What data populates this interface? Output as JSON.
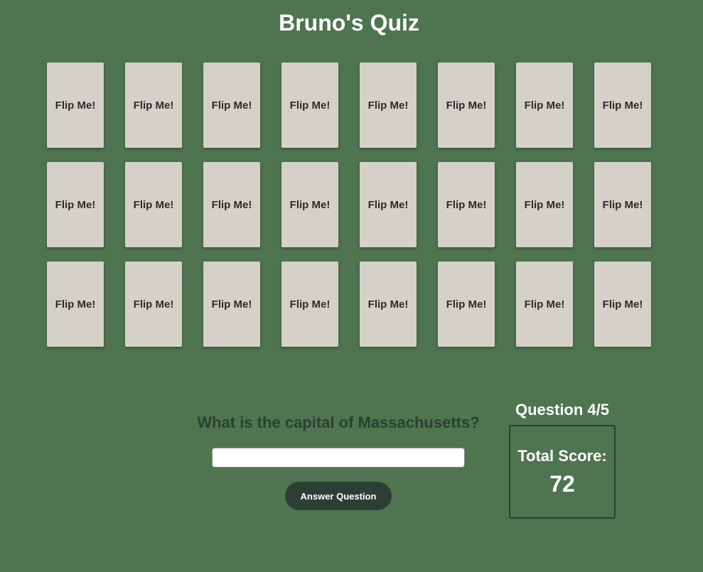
{
  "title": "Bruno's Quiz",
  "cards": [
    {
      "label": "Flip Me!"
    },
    {
      "label": "Flip Me!"
    },
    {
      "label": "Flip Me!"
    },
    {
      "label": "Flip Me!"
    },
    {
      "label": "Flip Me!"
    },
    {
      "label": "Flip Me!"
    },
    {
      "label": "Flip Me!"
    },
    {
      "label": "Flip Me!"
    },
    {
      "label": "Flip Me!"
    },
    {
      "label": "Flip Me!"
    },
    {
      "label": "Flip Me!"
    },
    {
      "label": "Flip Me!"
    },
    {
      "label": "Flip Me!"
    },
    {
      "label": "Flip Me!"
    },
    {
      "label": "Flip Me!"
    },
    {
      "label": "Flip Me!"
    },
    {
      "label": "Flip Me!"
    },
    {
      "label": "Flip Me!"
    },
    {
      "label": "Flip Me!"
    },
    {
      "label": "Flip Me!"
    },
    {
      "label": "Flip Me!"
    },
    {
      "label": "Flip Me!"
    },
    {
      "label": "Flip Me!"
    },
    {
      "label": "Flip Me!"
    }
  ],
  "quiz": {
    "question": "What is the capital of Massachusetts?",
    "answer_value": "",
    "answer_placeholder": "",
    "submit_label": "Answer Question"
  },
  "status": {
    "question_counter": "Question 4/5",
    "score_label": "Total Score:",
    "score_value": "72"
  },
  "colors": {
    "background": "#4e7550",
    "card": "#d5d1c9",
    "dark_accent": "#2d3f34",
    "text_light": "#ffffff"
  }
}
